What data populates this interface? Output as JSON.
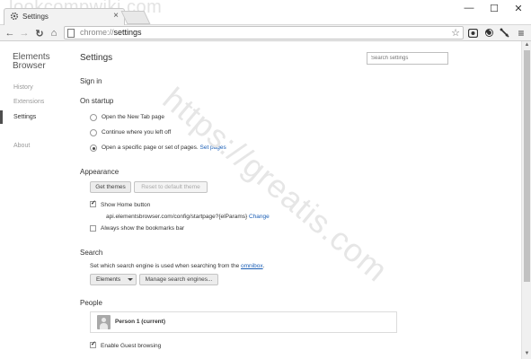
{
  "watermark_top": "lookcompwiki.com",
  "watermark_diag": "https://greatis.com",
  "tab": {
    "title": "Settings",
    "close": "×"
  },
  "window": {
    "minimize": "—",
    "maximize": "☐",
    "close": "✕"
  },
  "toolbar": {
    "back": "←",
    "forward": "→",
    "reload": "↻",
    "home": "⌂",
    "url_scheme": "chrome://",
    "url_path": "settings",
    "star": "☆",
    "menu": "≡"
  },
  "sidebar": {
    "brand": "Elements Browser",
    "items": [
      {
        "label": "History"
      },
      {
        "label": "Extensions"
      },
      {
        "label": "Settings"
      },
      {
        "label": "About"
      }
    ]
  },
  "main": {
    "title": "Settings",
    "search_placeholder": "Search settings",
    "sign_in": "Sign in",
    "startup": {
      "heading": "On startup",
      "options": [
        {
          "label": "Open the New Tab page"
        },
        {
          "label": "Continue where you left off"
        },
        {
          "label": "Open a specific page or set of pages.",
          "link": "Set pages"
        }
      ],
      "selected_index": 2
    },
    "appearance": {
      "heading": "Appearance",
      "get_themes": "Get themes",
      "reset_theme": "Reset to default theme",
      "show_home": "Show Home button",
      "home_url": "api.elementsbrowser.com/config/startpage?{elParams}",
      "change": "Change",
      "bookmarks_bar": "Always show the bookmarks bar"
    },
    "search": {
      "heading": "Search",
      "desc": "Set which search engine is used when searching from the",
      "omnibox_link": "omnibox",
      "desc_end": ".",
      "engine": "Elements",
      "manage": "Manage search engines..."
    },
    "people": {
      "heading": "People",
      "person": "Person 1 (current)",
      "guest": "Enable Guest browsing"
    }
  }
}
